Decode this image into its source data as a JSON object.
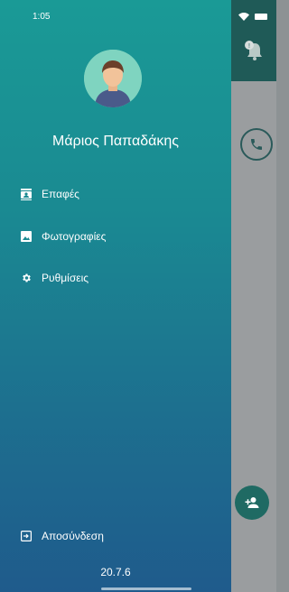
{
  "status_bar": {
    "time": "1:05"
  },
  "drawer": {
    "user_name": "Μάριος Παπαδάκης",
    "menu": [
      {
        "label": "Επαφές",
        "icon": "contacts-icon"
      },
      {
        "label": "Φωτογραφίες",
        "icon": "photo-icon"
      },
      {
        "label": "Ρυθμίσεις",
        "icon": "gear-icon"
      }
    ],
    "logout_label": "Αποσύνδεση",
    "version": "20.7.6"
  },
  "colors": {
    "drawer_top": "#1a9a96",
    "drawer_bottom": "#1f5b8c",
    "app_header": "#1f5a57",
    "fab": "#1f6a63"
  }
}
